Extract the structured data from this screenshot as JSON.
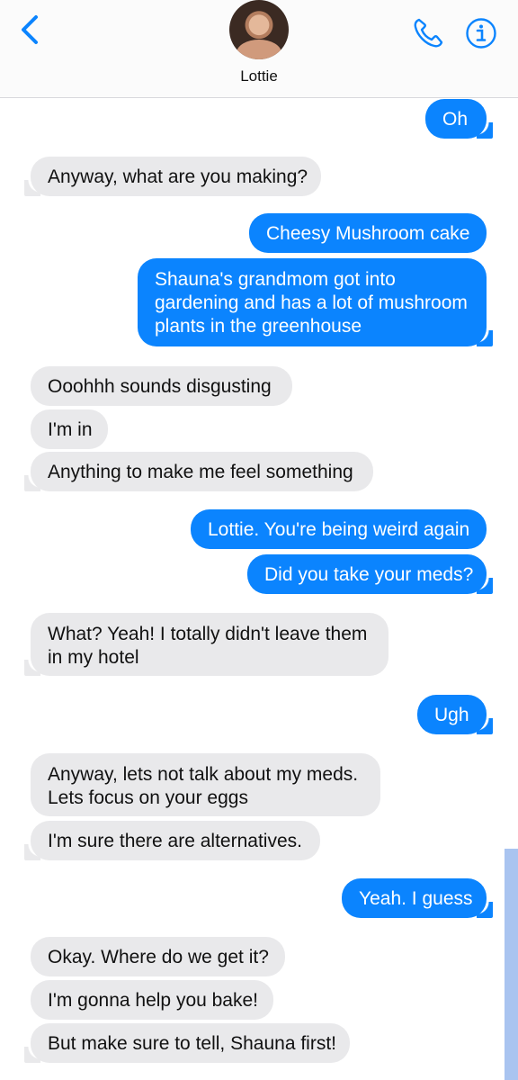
{
  "header": {
    "contact_name": "Lottie"
  },
  "messages": [
    {
      "from": "me",
      "text": "Oh"
    },
    {
      "from": "them",
      "text": "Anyway, what are you making?"
    },
    {
      "from": "me",
      "text": "Cheesy Mushroom cake"
    },
    {
      "from": "me",
      "line1": "Shauna's grandmom got into",
      "line2": "gardening and has a lot of mushroom",
      "line3": "plants in the greenhouse"
    },
    {
      "from": "them",
      "text": "Ooohhh sounds disgusting"
    },
    {
      "from": "them",
      "text": "I'm in"
    },
    {
      "from": "them",
      "text": "Anything to make me feel something"
    },
    {
      "from": "me",
      "text": "Lottie. You're being weird again"
    },
    {
      "from": "me",
      "text": "Did you take your meds?"
    },
    {
      "from": "them",
      "line1": "What? Yeah! I totally didn't leave them",
      "line2": "in my hotel"
    },
    {
      "from": "me",
      "text": "Ugh"
    },
    {
      "from": "them",
      "line1": "Anyway, lets not talk about my meds.",
      "line2": "Lets focus on your eggs"
    },
    {
      "from": "them",
      "text": "I'm sure there are alternatives."
    },
    {
      "from": "me",
      "text": "Yeah. I guess"
    },
    {
      "from": "them",
      "text": "Okay. Where do we get it?"
    },
    {
      "from": "them",
      "text": "I'm gonna help you bake!"
    },
    {
      "from": "them",
      "text": "But make sure to tell, Shauna first!"
    }
  ],
  "colors": {
    "sent_bubble": "#0b84fe",
    "received_bubble": "#e9e9eb",
    "accent": "#0b84fe"
  },
  "icons": [
    "chevron-left-icon",
    "phone-icon",
    "info-icon"
  ]
}
